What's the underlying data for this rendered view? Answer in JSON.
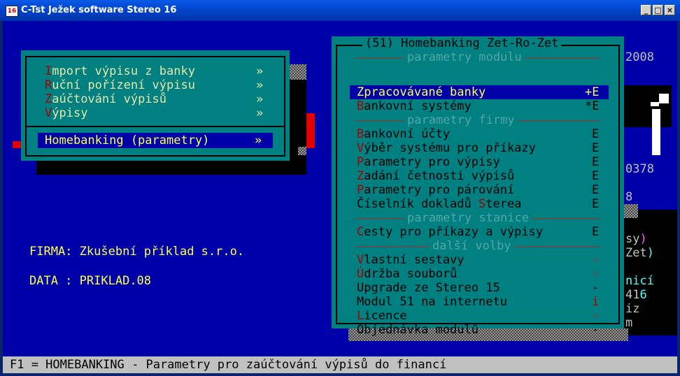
{
  "window": {
    "title": "C-Tst Ježek software Stereo 16",
    "icon_text": "16"
  },
  "titlebar_buttons": {
    "minimize": "_",
    "maximize": "□",
    "close": "×"
  },
  "main_menu": [
    {
      "hot": "I",
      "rest": "mport výpisu z banky",
      "arrow": "»"
    },
    {
      "hot": "R",
      "rest": "uční pořízení výpisu",
      "arrow": "»"
    },
    {
      "hot": "Z",
      "rest": "aúčtování výpisů",
      "arrow": "»"
    },
    {
      "hot": "V",
      "rest": "ýpisy",
      "arrow": "»"
    }
  ],
  "main_menu_selected": {
    "label": "Homebanking (parametry)",
    "arrow": "»"
  },
  "company": {
    "firma_label": "FIRMA:",
    "firma_value": "Zkušební příklad s.r.o.",
    "data_label": "DATA :",
    "data_value": "PRIKLAD.08"
  },
  "background_fragments": {
    "year": "2008",
    "num1": "0378",
    "num2": "8",
    "sy": "sy",
    "paren1": ")",
    "zet": "Zet",
    "paren2": ")",
    "nici": "nicí",
    "n41": "41",
    "n6": "6",
    "iz": "iz",
    "m": "m"
  },
  "submenu": {
    "title": "(51) Homebanking Zet-Ro-Zet",
    "sections": {
      "modulu": "parametry modulu",
      "firmy": "parametry firmy",
      "stanice": "parametry stanice",
      "dalsi": "další volby"
    },
    "selected": {
      "label": "Zpracovávané banky",
      "flag": "+E"
    },
    "items": [
      {
        "hot": "B",
        "rest": "ankovní systémy",
        "flag": "*E"
      },
      {
        "hot": "B",
        "rest": "ankovní účty",
        "flag": "E"
      },
      {
        "hot": "V",
        "rest": "ýběr systému pro příkazy",
        "flag": "E"
      },
      {
        "hot": "P",
        "rest": "arametry pro výpisy",
        "flag": "E"
      },
      {
        "hot": "Z",
        "rest": "adání četnosti výpisů",
        "flag": "E"
      },
      {
        "hot": "P",
        "rest": "arametry pro párování",
        "flag": "E"
      },
      {
        "pre": "Číselník dokladů ",
        "hot": "S",
        "rest": "terea",
        "flag": "E"
      },
      {
        "hot": "C",
        "rest": "esty pro příkazy a výpisy",
        "flag": "E"
      },
      {
        "hot": "V",
        "rest": "lastní sestavy",
        "flag": "»"
      },
      {
        "hot": "Ú",
        "rest": "držba souborů",
        "flag": "»"
      },
      {
        "hot": "",
        "rest": "Upgrade ze Stereo 15",
        "flag": "-"
      },
      {
        "hot": "",
        "rest": "Modul 51 na internetu",
        "flag": "i"
      },
      {
        "hot": "L",
        "rest": "icence",
        "flag": "»"
      },
      {
        "hot": "",
        "rest": "Objednávka modulů",
        "flag": "-"
      }
    ]
  },
  "status_bar": "F1 = HOMEBANKING - Parametry pro zaúčtování výpisů do financí",
  "colors": {
    "background": "#0000a8",
    "panel": "#008080",
    "highlight": "#ffff55",
    "hotkey": "#a80000",
    "status": "#c0c0c0"
  }
}
